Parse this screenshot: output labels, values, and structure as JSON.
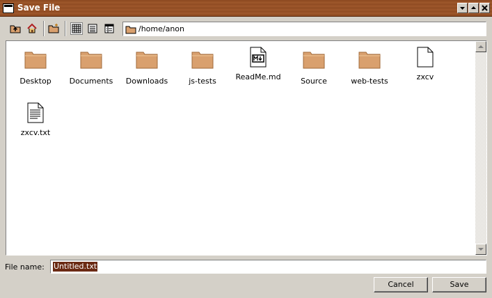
{
  "window": {
    "title": "Save File",
    "buttons": [
      "minimize",
      "maximize",
      "close"
    ]
  },
  "toolbar": {
    "path": "/home/anon",
    "icons": [
      "up-folder-icon",
      "home-icon",
      "new-folder-icon",
      "icon-view-icon",
      "list-view-icon",
      "detail-view-icon"
    ]
  },
  "files": [
    {
      "name": "Desktop",
      "type": "folder"
    },
    {
      "name": "Documents",
      "type": "folder"
    },
    {
      "name": "Downloads",
      "type": "folder"
    },
    {
      "name": "js-tests",
      "type": "folder"
    },
    {
      "name": "ReadMe.md",
      "type": "markdown"
    },
    {
      "name": "Source",
      "type": "folder"
    },
    {
      "name": "web-tests",
      "type": "folder"
    },
    {
      "name": "zxcv",
      "type": "file"
    },
    {
      "name": "zxcv.txt",
      "type": "text"
    }
  ],
  "filename": {
    "label": "File name:",
    "value": "Untitled.txt"
  },
  "actions": {
    "cancel": "Cancel",
    "save": "Save"
  },
  "colors": {
    "titlebar": "#9a5226",
    "folder": "#d9a06e",
    "selection": "#6b2a14"
  }
}
